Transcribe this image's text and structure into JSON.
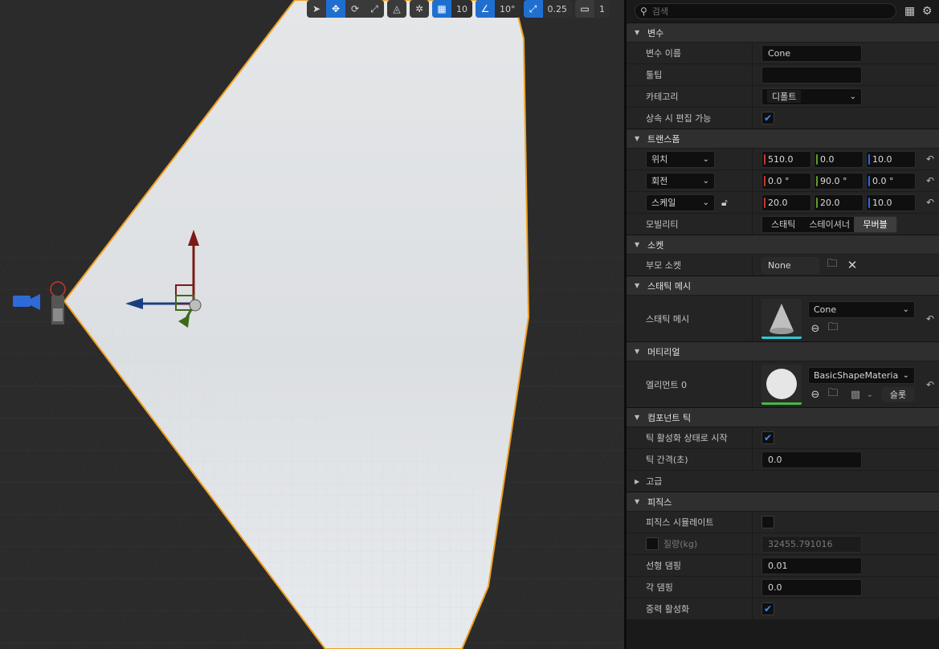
{
  "viewport": {
    "toolbar": {
      "grid_snap_value": "10",
      "rotation_snap_value": "10°",
      "scale_snap_value": "0.25",
      "camera_speed_value": "1"
    }
  },
  "search": {
    "placeholder": "검색"
  },
  "sections": {
    "variable": {
      "title": "변수",
      "name_label": "변수 이름",
      "name_value": "Cone",
      "tooltip_label": "툴팁",
      "tooltip_value": "",
      "category_label": "카테고리",
      "category_value": "디폴트",
      "editable_label": "상속 시 편집 가능",
      "editable_checked": true
    },
    "transform": {
      "title": "트랜스폼",
      "location_label": "위치",
      "location": [
        "510.0",
        "0.0",
        "10.0"
      ],
      "rotation_label": "회전",
      "rotation": [
        "0.0 °",
        "90.0 °",
        "0.0 °"
      ],
      "scale_label": "스케일",
      "scale": [
        "20.0",
        "20.0",
        "10.0"
      ],
      "mobility_label": "모빌리티",
      "mobility_options": [
        "스태틱",
        "스테이셔너",
        "무버블"
      ],
      "mobility_selected": "무버블"
    },
    "socket": {
      "title": "소켓",
      "parent_label": "부모 소켓",
      "parent_value": "None"
    },
    "static_mesh": {
      "title": "스태틱 메시",
      "mesh_label": "스태틱 메시",
      "mesh_value": "Cone"
    },
    "materials": {
      "title": "머티리얼",
      "element_label": "엘리먼트 0",
      "element_value": "BasicShapeMateria",
      "slot_button": "슬롯"
    },
    "component_tick": {
      "title": "컴포넌트 틱",
      "start_enabled_label": "틱 활성화 상태로 시작",
      "start_enabled_checked": true,
      "interval_label": "틱 간격(초)",
      "interval_value": "0.0"
    },
    "advanced": {
      "title": "고급"
    },
    "physics": {
      "title": "피직스",
      "simulate_label": "피직스 시뮬레이트",
      "simulate_checked": false,
      "mass_label": "질량(kg)",
      "mass_value": "32455.791016",
      "linear_damping_label": "선형 댐핑",
      "linear_damping_value": "0.01",
      "angular_damping_label": "각 댐핑",
      "angular_damping_value": "0.0",
      "gravity_label": "중력 활성화",
      "gravity_checked": true
    }
  },
  "colors": {
    "accent": "#1f6fd1",
    "selection_outline": "#f0a020",
    "axis_x": "#c23a2a",
    "axis_y": "#5e9b2a",
    "axis_z": "#2f6ad9"
  }
}
